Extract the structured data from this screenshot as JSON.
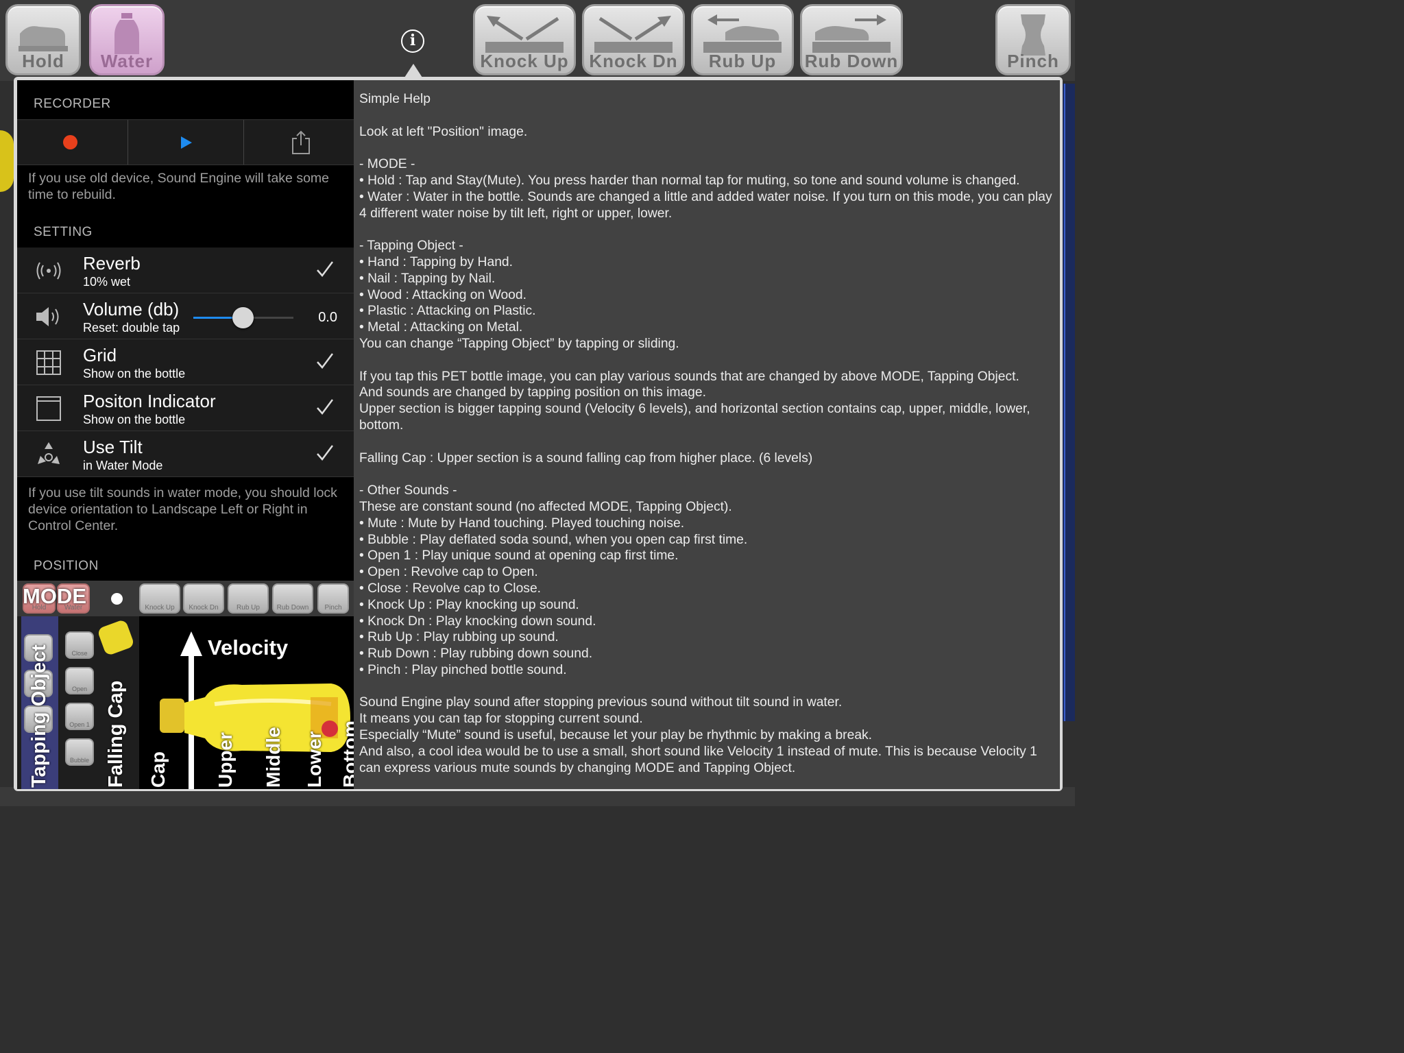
{
  "toolbar": {
    "hold": "Hold",
    "water": "Water",
    "knock_up": "Knock Up",
    "knock_dn": "Knock Dn",
    "rub_up": "Rub Up",
    "rub_down": "Rub Down",
    "pinch": "Pinch",
    "info_glyph": "i"
  },
  "recorder": {
    "header": "RECORDER",
    "note": "If you use old device, Sound Engine will take some time to rebuild."
  },
  "setting": {
    "header": "SETTING",
    "reverb": {
      "title": "Reverb",
      "sub": "10% wet",
      "checked": true
    },
    "volume": {
      "title": "Volume (db)",
      "sub": "Reset: double tap",
      "value": "0.0",
      "slider_fraction": 0.5
    },
    "grid": {
      "title": "Grid",
      "sub": "Show on the bottle",
      "checked": true
    },
    "indicator": {
      "title": "Positon Indicator",
      "sub": "Show on the bottle",
      "checked": true
    },
    "tilt": {
      "title": "Use Tilt",
      "sub": "in Water Mode",
      "checked": true
    },
    "note": "If you use tilt sounds in water mode, you should lock device orientation to Landscape Left or Right in Control Center."
  },
  "position": {
    "header": "POSITION",
    "mode_label": "MODE",
    "mini_hold": "Hold",
    "mini_water": "Water",
    "mini_knock_up": "Knock Up",
    "mini_knock_dn": "Knock Dn",
    "mini_rub_up": "Rub Up",
    "mini_rub_down": "Rub Down",
    "mini_pinch": "Pinch",
    "side_close": "Close",
    "side_open": "Open",
    "side_open1": "Open 1",
    "side_bubble": "Bubble",
    "tapping_object": "Tapping Object",
    "falling_cap": "Falling Cap",
    "velocity": "Velocity",
    "cap": "Cap",
    "upper": "Upper",
    "middle": "Middle",
    "lower": "Lower",
    "bottom": "Bottom"
  },
  "help": {
    "text": "Simple Help\n\nLook at left \"Position\" image.\n\n- MODE -\n• Hold : Tap and Stay(Mute). You press harder than normal tap for muting, so tone and sound volume is changed.\n• Water : Water in the bottle. Sounds are changed a little and added water noise. If you turn on this mode, you can play 4 different water noise by tilt left, right or upper, lower.\n\n- Tapping Object -\n• Hand : Tapping by Hand.\n• Nail : Tapping by Nail.\n• Wood : Attacking on Wood.\n• Plastic : Attacking on Plastic.\n• Metal : Attacking on Metal.\nYou can change “Tapping Object” by tapping or sliding.\n\nIf you tap this PET bottle image, you can play various sounds that are changed by above MODE, Tapping Object.\nAnd sounds are changed by tapping position on this image.\nUpper section is bigger tapping sound (Velocity 6 levels), and horizontal section contains cap, upper, middle, lower, bottom.\n\nFalling Cap : Upper section is a sound falling cap from higher place. (6 levels)\n\n- Other Sounds -\nThese are constant sound (no affected MODE, Tapping Object).\n• Mute : Mute by Hand touching. Played touching noise.\n• Bubble : Play deflated soda sound, when you open cap first time.\n• Open 1 : Play unique sound at opening cap first time.\n• Open : Revolve cap to Open.\n• Close : Revolve cap to Close.\n• Knock Up : Play knocking up sound.\n• Knock Dn : Play knocking down sound.\n• Rub Up : Play rubbing up sound.\n• Rub Down : Play rubbing down sound.\n• Pinch : Play pinched bottle sound.\n\nSound Engine play sound after stopping previous sound without tilt sound in water.\nIt means you can tap for stopping current sound.\nEspecially “Mute” sound is useful, because let your play be rhythmic by making a break.\nAnd also, a cool idea would be to use a small, short sound like Velocity 1 instead of mute. This is because Velocity 1 can express various mute sounds by changing MODE and Tapping Object."
  },
  "colors": {
    "record": "#e8401c",
    "play": "#1e8bef",
    "accent_pink": "#cfa1cb"
  }
}
